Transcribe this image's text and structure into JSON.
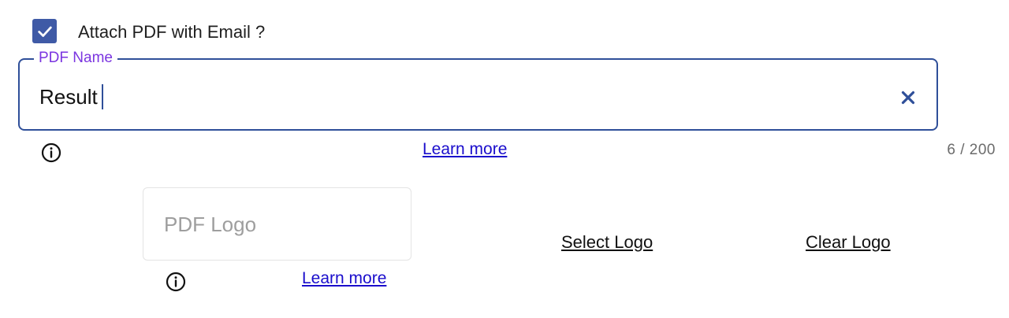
{
  "attach_pdf": {
    "checked": true,
    "label": "Attach PDF with Email ?",
    "icon": "check-icon"
  },
  "pdf_name": {
    "label": "PDF Name",
    "value": "Result",
    "clear_icon": "close-icon",
    "info_icon": "info-icon",
    "learn_more": "Learn more",
    "counter": "6 / 200"
  },
  "pdf_logo": {
    "placeholder": "PDF Logo",
    "info_icon": "info-icon",
    "learn_more": "Learn more",
    "select_label": "Select Logo",
    "clear_label": "Clear Logo"
  },
  "colors": {
    "accent": "#3f5aa6",
    "field_border": "#2f4f99",
    "floating_label": "#7b35e0",
    "link": "#1a0dcc"
  }
}
